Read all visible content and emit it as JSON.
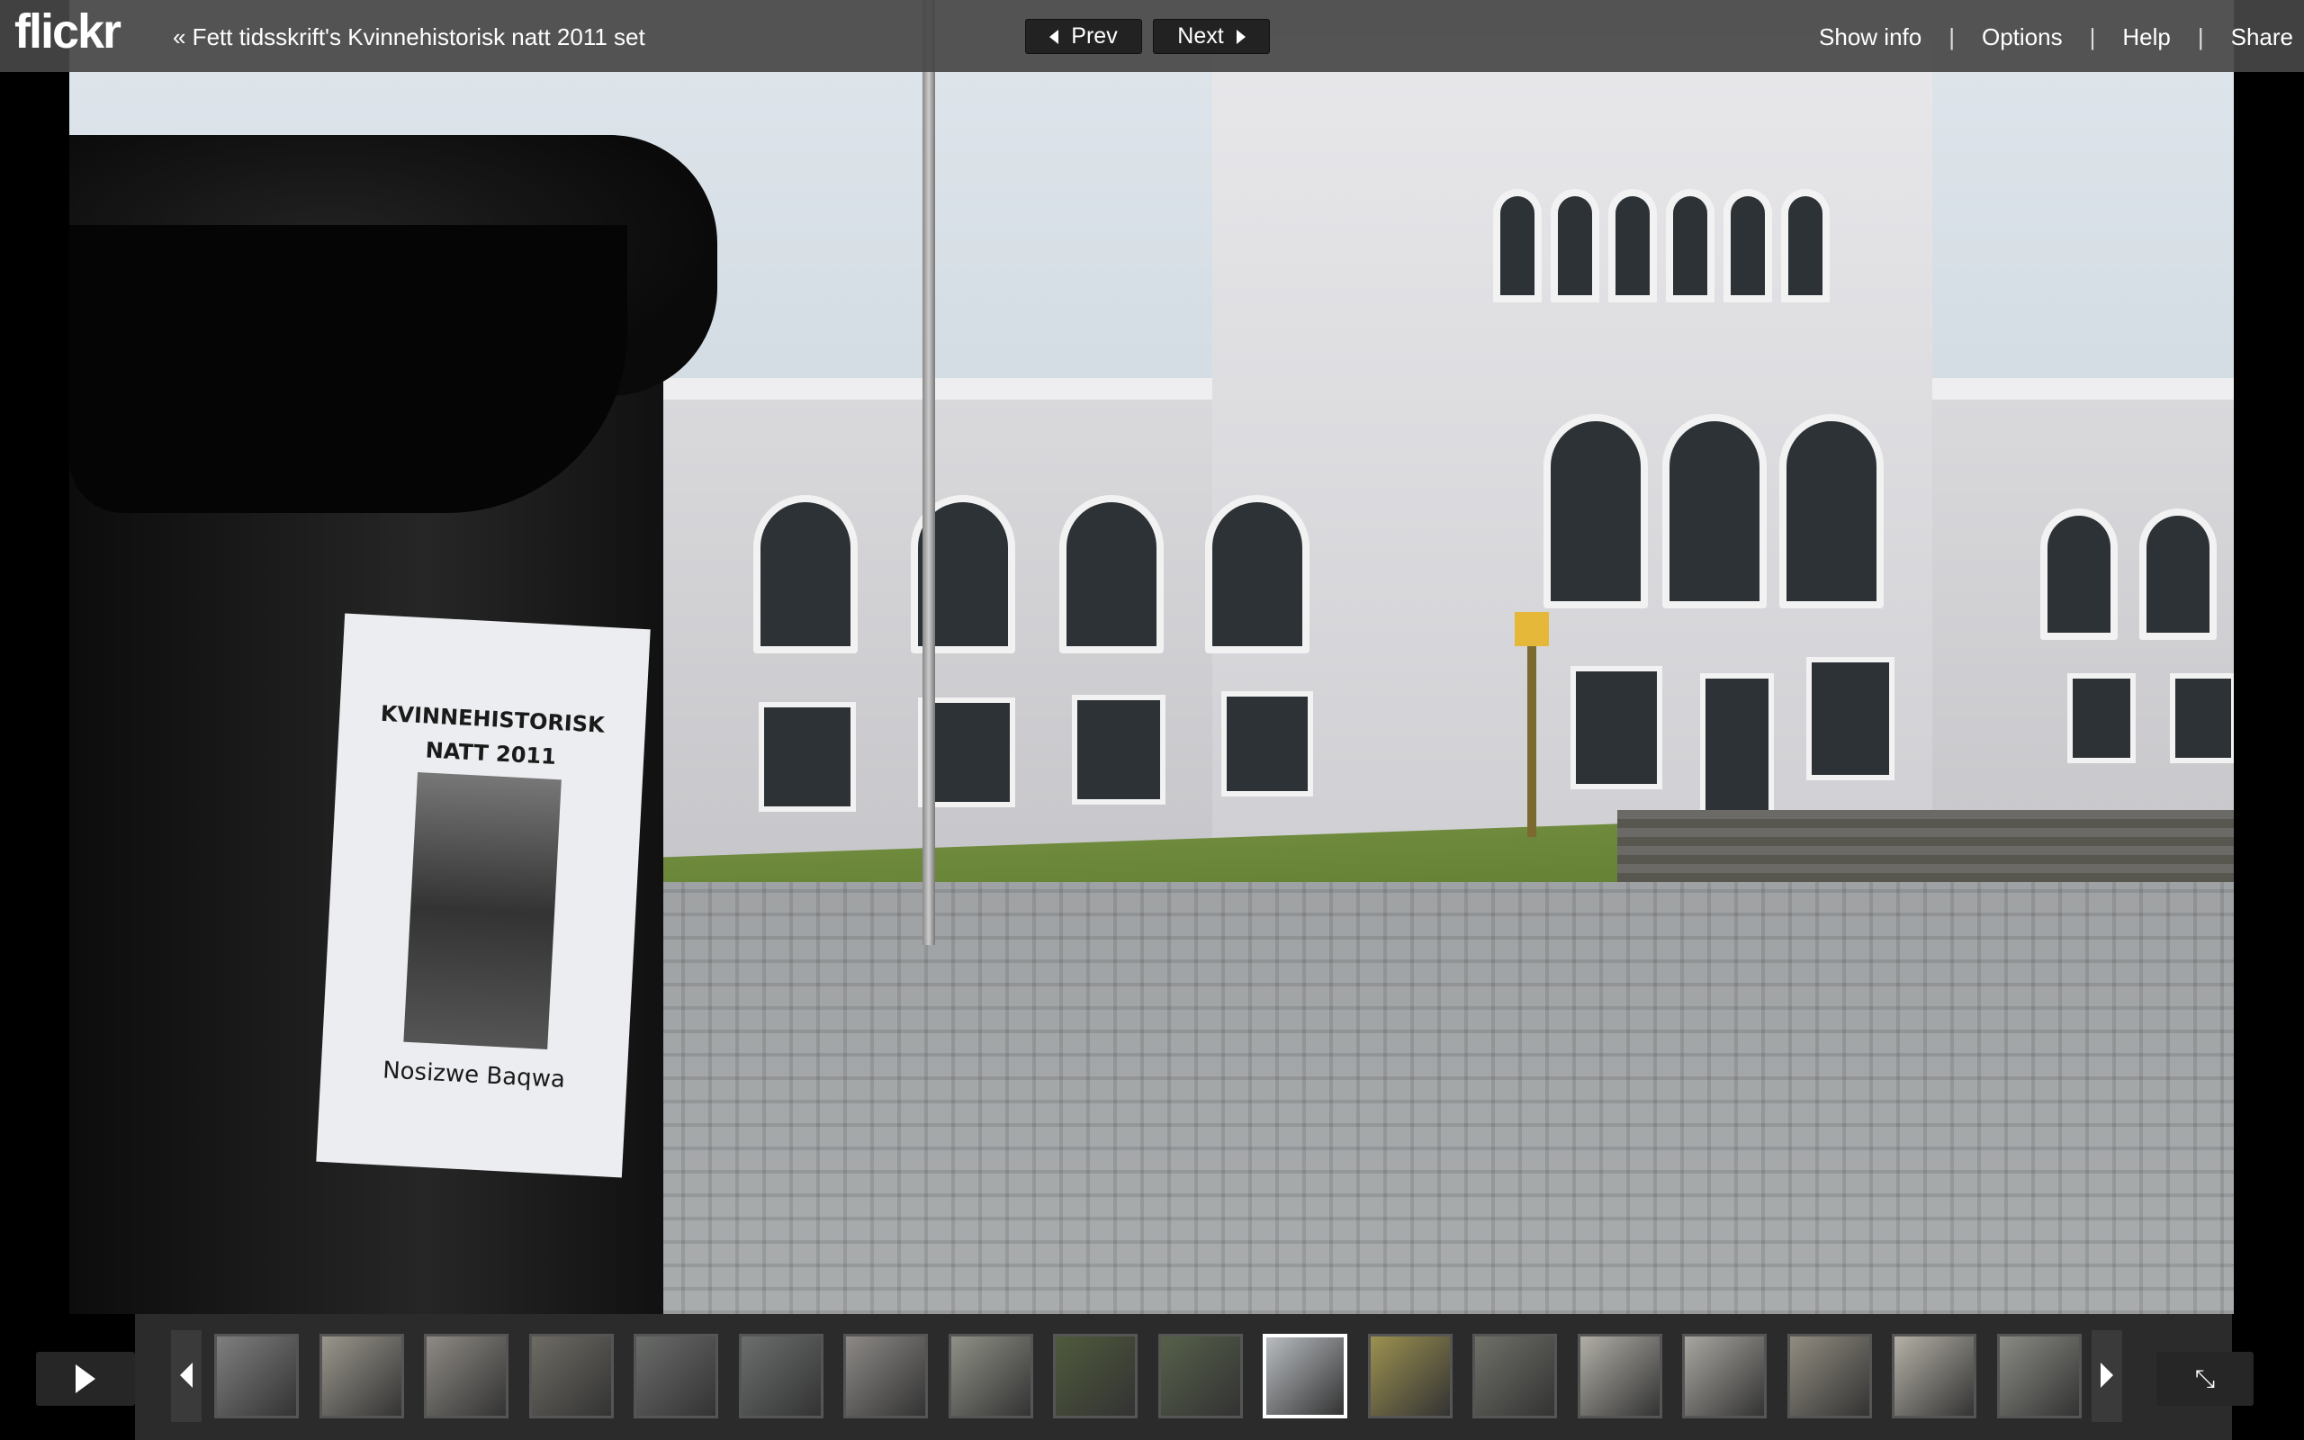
{
  "header": {
    "logo": "flickr",
    "set_link": "« Fett tidsskrift's Kvinnehistorisk natt 2011 set",
    "prev_label": "Prev",
    "next_label": "Next",
    "menu": [
      "Show info",
      "Options",
      "Help",
      "Share"
    ],
    "menu_separator": "|"
  },
  "photo": {
    "poster_title_line1": "KVINNEHISTORISK",
    "poster_title_line2": "NATT 2011",
    "poster_name": "Nosizwe Baqwa"
  },
  "filmstrip": {
    "thumbnails": [
      {
        "color": "#7f7f7f"
      },
      {
        "color": "#9a968c"
      },
      {
        "color": "#8e8a84"
      },
      {
        "color": "#6d6b63"
      },
      {
        "color": "#6a6c6a"
      },
      {
        "color": "#6c6e6e"
      },
      {
        "color": "#8c8986"
      },
      {
        "color": "#8f9086"
      },
      {
        "color": "#4f5a3c"
      },
      {
        "color": "#56604a"
      },
      {
        "color": "#b8bcc0"
      },
      {
        "color": "#9c9150"
      },
      {
        "color": "#6f7068"
      },
      {
        "color": "#b0aea6"
      },
      {
        "color": "#a8a6a0"
      },
      {
        "color": "#918c80"
      },
      {
        "color": "#b4b0a6"
      },
      {
        "color": "#8a8a84"
      }
    ],
    "active_index": 10,
    "fullscreen_glyph": "⤡"
  },
  "colors": {
    "topbar": "#464646",
    "filmstrip": "#2d2d2d"
  }
}
